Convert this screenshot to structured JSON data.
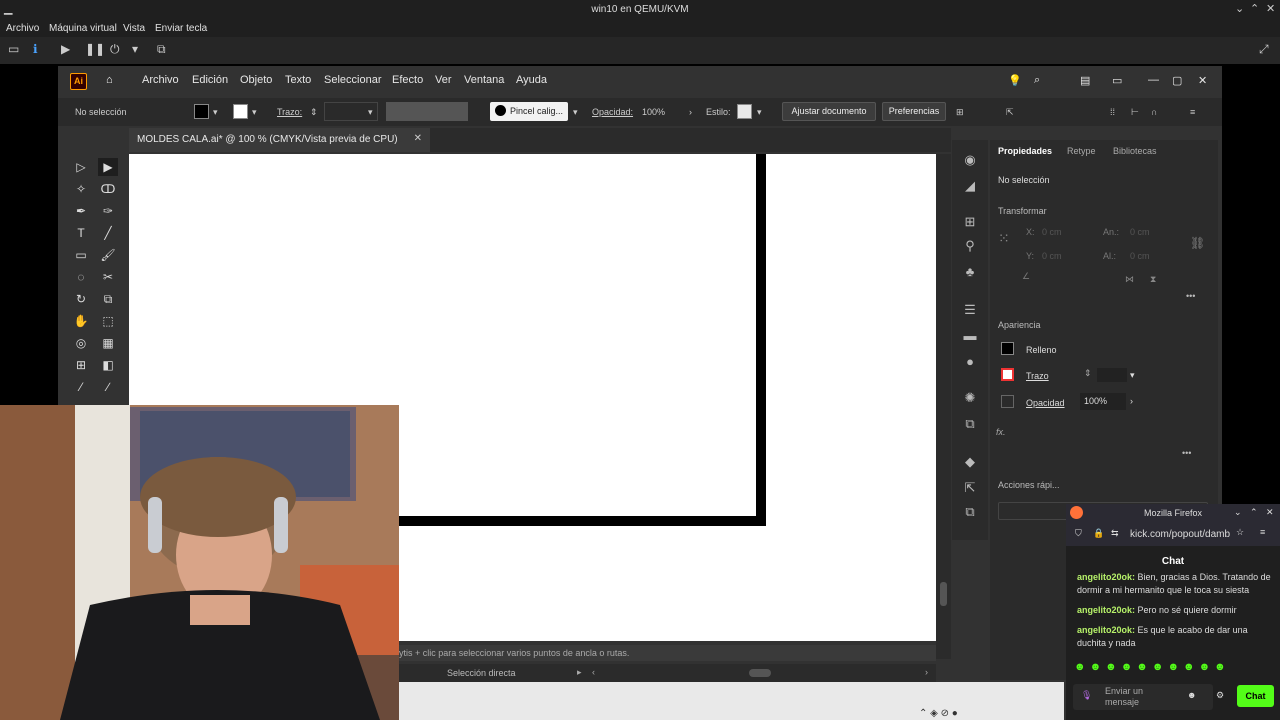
{
  "host": {
    "title": "win10 en QEMU/KVM",
    "menu": [
      "Archivo",
      "Máquina virtual",
      "Vista",
      "Enviar tecla"
    ]
  },
  "ai": {
    "logo": "Ai",
    "menu": [
      "Archivo",
      "Edición",
      "Objeto",
      "Texto",
      "Seleccionar",
      "Efecto",
      "Ver",
      "Ventana",
      "Ayuda"
    ],
    "control": {
      "selection": "No selección",
      "stroke_label": "Trazo:",
      "brush": "Pincel calig...",
      "opacity_label": "Opacidad:",
      "opacity_value": "100%",
      "style_label": "Estilo:",
      "fit_button": "Ajustar documento",
      "prefs_button": "Preferencias"
    },
    "doc_tab": "MOLDES CALA.ai* @ 100 % (CMYK/Vista previa de CPU)",
    "status_hint": "ytis + clic para seleccionar varios puntos de ancla o rutas.",
    "status_tool": "Selección directa",
    "panel": {
      "tabs": [
        "Propiedades",
        "Retype",
        "Bibliotecas"
      ],
      "no_selection": "No selección",
      "transform": "Transformar",
      "x_label": "X:",
      "y_label": "Y:",
      "w_label": "An.:",
      "h_label": "Al.:",
      "x_value": "0 cm",
      "y_value": "0 cm",
      "w_value": "0 cm",
      "h_value": "0 cm",
      "appearance": "Apariencia",
      "fill": "Relleno",
      "stroke": "Trazo",
      "opacity": "Opacidad",
      "opacity_value": "100%",
      "fx": "fx.",
      "quick_actions": "Acciones rápi..."
    }
  },
  "firefox": {
    "title": "Mozilla Firefox",
    "url": "kick.com/popout/damb",
    "chat_header": "Chat",
    "messages": [
      {
        "user": "angelito20ok:",
        "text": "Bien, gracias a Dios. Tratando de dormir a mi hermanito que le toca su siesta"
      },
      {
        "user": "angelito20ok:",
        "text": "Pero no sé quiere dormir"
      },
      {
        "user": "angelito20ok:",
        "text": "Es que le acabo de dar una duchita y nada"
      }
    ],
    "input_placeholder": "Enviar un mensaje",
    "send_button": "Chat"
  },
  "colors": {
    "accent_orange": "#ff9a00",
    "kick_green": "#53fc18"
  }
}
